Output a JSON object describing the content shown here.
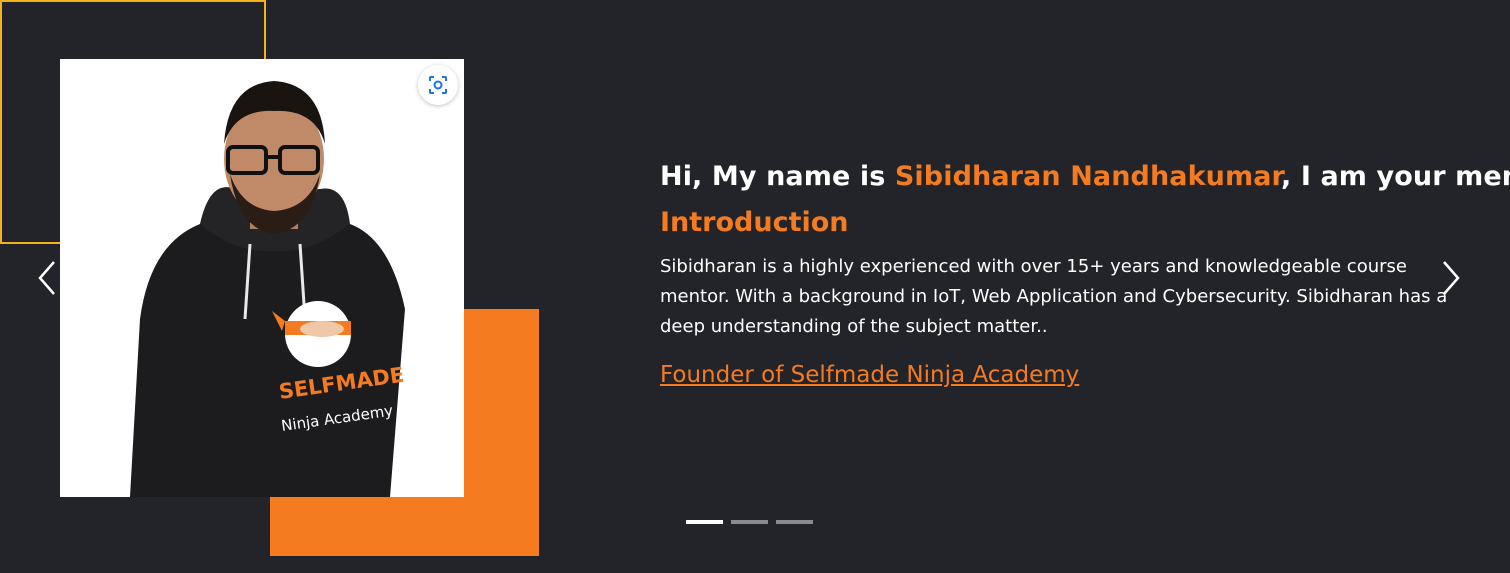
{
  "hero": {
    "headline_prefix": "Hi, My name is ",
    "name": "Sibidharan Nandhakumar",
    "headline_suffix": ", I am your mentor",
    "section_title": "Introduction",
    "bio": "Sibidharan is a highly experienced with over 15+ years and knowledgeable course mentor. With a background in IoT, Web Application and Cybersecurity. Sibidharan has a deep understanding of the subject matter..",
    "link_text": "Founder of Selfmade Ninja Academy"
  },
  "photo": {
    "hoodie_line1": "SELFMADE",
    "hoodie_line2": "Ninja Academy",
    "lens_icon": "visual-search-icon"
  },
  "carousel": {
    "prev_icon": "chevron-left-icon",
    "next_icon": "chevron-right-icon",
    "slide_count": 3,
    "active_slide": 1
  },
  "colors": {
    "background": "#22242a",
    "accent_orange": "#f47b20",
    "frame_yellow": "#f5b21a",
    "text": "#ffffff"
  }
}
